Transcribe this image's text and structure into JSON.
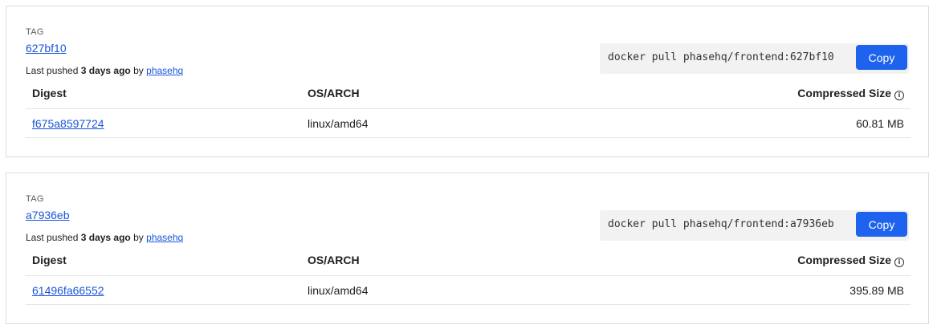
{
  "tags": [
    {
      "label": "TAG",
      "name": "627bf10",
      "last_pushed_prefix": "Last pushed",
      "last_pushed_time": "3 days ago",
      "by": "by",
      "user": "phasehq",
      "pull_command": "docker pull phasehq/frontend:627bf10",
      "copy_label": "Copy",
      "columns": {
        "digest": "Digest",
        "os_arch": "OS/ARCH",
        "size": "Compressed Size"
      },
      "rows": [
        {
          "digest": "f675a8597724",
          "os_arch": "linux/amd64",
          "size": "60.81 MB"
        }
      ]
    },
    {
      "label": "TAG",
      "name": "a7936eb",
      "last_pushed_prefix": "Last pushed",
      "last_pushed_time": "3 days ago",
      "by": "by",
      "user": "phasehq",
      "pull_command": "docker pull phasehq/frontend:a7936eb",
      "copy_label": "Copy",
      "columns": {
        "digest": "Digest",
        "os_arch": "OS/ARCH",
        "size": "Compressed Size"
      },
      "rows": [
        {
          "digest": "61496fa66552",
          "os_arch": "linux/amd64",
          "size": "395.89 MB"
        }
      ]
    }
  ],
  "icons": {
    "info": "info-circle-icon"
  },
  "colors": {
    "link": "#1a55d8",
    "button": "#1d63ed",
    "pull_box": "#f2f2f2",
    "border": "#dcdcdc"
  }
}
